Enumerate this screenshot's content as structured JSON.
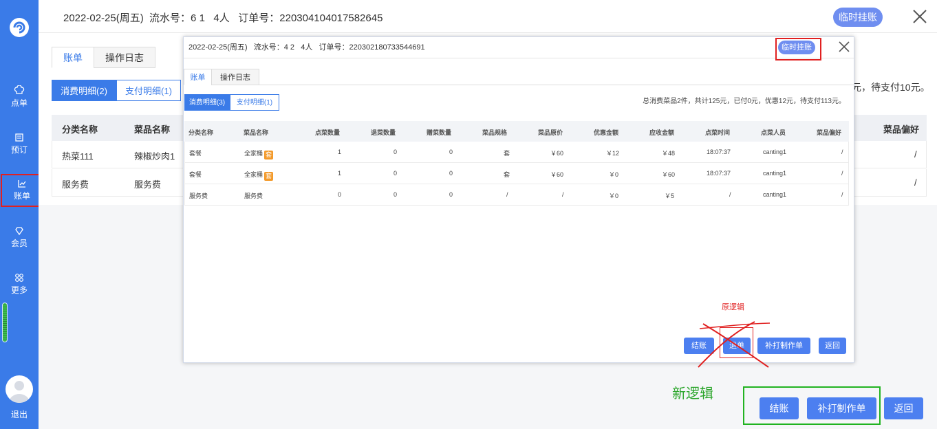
{
  "sidebar": {
    "items": [
      {
        "label": "点单",
        "icon": "chef-hat-icon"
      },
      {
        "label": "预订",
        "icon": "booking-icon"
      },
      {
        "label": "账单",
        "icon": "chart-icon"
      },
      {
        "label": "会员",
        "icon": "diamond-icon"
      },
      {
        "label": "更多",
        "icon": "grid-icon"
      }
    ],
    "logout": "退出"
  },
  "header": {
    "info": "2022-02-25(周五)  流水号：6 1   4人   订单号：220304104017582645",
    "temp_credit": "临时挂账"
  },
  "main": {
    "tabs": [
      "账单",
      "操作日志"
    ],
    "subtabs": [
      "消费明细(2)",
      "支付明细(1)"
    ],
    "summary_tail": "元，待支付10元。",
    "table": {
      "headers": {
        "category": "分类名称",
        "dish": "菜品名称",
        "preference": "菜品偏好"
      },
      "rows": [
        {
          "category": "热菜111",
          "dish": "辣椒炒肉1",
          "preference": "/"
        },
        {
          "category": "服务费",
          "dish": "服务费",
          "preference": "/"
        }
      ]
    }
  },
  "new_logic": {
    "label": "新逻辑",
    "settle": "结账",
    "reprint": "补打制作单",
    "back": "返回"
  },
  "modal": {
    "info": "2022-02-25(周五)   流水号：4 2   4人   订单号：220302180733544691",
    "temp_credit": "临时挂账",
    "tabs": [
      "账单",
      "操作日志"
    ],
    "subtabs": [
      "消费明细(3)",
      "支付明细(1)"
    ],
    "summary": "总消费菜品2件，共计125元，已付0元，优惠12元，待支付113元。",
    "headers": [
      "分类名称",
      "菜品名称",
      "点菜数量",
      "退菜数量",
      "赠菜数量",
      "菜品规格",
      "菜品原价",
      "优惠金额",
      "应收金额",
      "点菜时间",
      "点菜人员",
      "菜品偏好"
    ],
    "rows": [
      {
        "category": "套餐",
        "dish": "全家桶",
        "tag": "套",
        "qty": "1",
        "refund": "0",
        "gift": "0",
        "spec": "套",
        "price": "￥60",
        "discount": "￥12",
        "receivable": "￥48",
        "time": "18:07:37",
        "staff": "canting1",
        "pref": "/"
      },
      {
        "category": "套餐",
        "dish": "全家桶",
        "tag": "套",
        "qty": "1",
        "refund": "0",
        "gift": "0",
        "spec": "套",
        "price": "￥60",
        "discount": "￥0",
        "receivable": "￥60",
        "time": "18:07:37",
        "staff": "canting1",
        "pref": "/"
      },
      {
        "category": "服务费",
        "dish": "服务费",
        "tag": "",
        "qty": "0",
        "refund": "0",
        "gift": "0",
        "spec": "/",
        "price": "/",
        "discount": "￥0",
        "receivable": "￥5",
        "time": "/",
        "staff": "canting1",
        "pref": "/"
      }
    ],
    "orig_logic": "原逻辑",
    "settle": "结账",
    "refund": "退单",
    "reprint": "补打制作单",
    "back": "返回"
  },
  "colors": {
    "primary": "#3a7be8",
    "button": "#4c7ff0",
    "highlight_red": "#e02020",
    "highlight_green": "#21b321"
  }
}
